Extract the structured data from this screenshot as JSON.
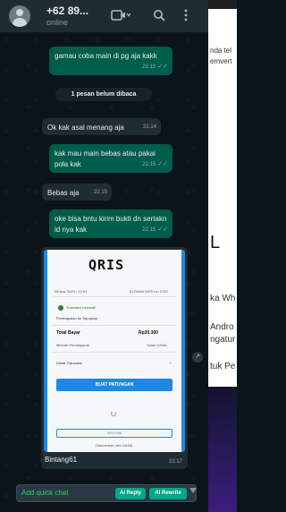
{
  "header": {
    "contact_name": "+62 89...",
    "status": "online"
  },
  "messages": [
    {
      "id": "m1",
      "dir": "out",
      "text": "gamau coba main di pg aja kakk",
      "time": "22.13"
    },
    {
      "id": "m2",
      "dir": "in",
      "text": "Ok kak asal menang aja",
      "time": "22.14"
    },
    {
      "id": "m3",
      "dir": "out",
      "text": "kak mau main bebas atau pakai pola kak",
      "time": "22.15"
    },
    {
      "id": "m4",
      "dir": "in",
      "text": "Bebas aja",
      "time": "22.15"
    },
    {
      "id": "m5",
      "dir": "out",
      "text": "oke bisa bntu kirim bukti dn sertakn id nya kak",
      "time": "22.15"
    }
  ],
  "unread_divider": "1 pesan belum dibaca",
  "image_message": {
    "caption": "Bintang61",
    "time": "22.17",
    "receipt": {
      "logo": "QRIS",
      "date_line": "06 Nov 2025 • 22:04",
      "id_line": "ID DANA 0870 •••• 2720",
      "status": "Transaksi berhasil!",
      "payee": "Pembayaran ke Topupkuy",
      "total_label": "Total Bayar",
      "total_value": "Rp30.300",
      "method_label": "Metode Pembayaran",
      "method_value": "Saldo DANA",
      "detail_label": "Detail Transaksi",
      "primary_button": "BUAT PATUNGAN",
      "secondary_button": "SELESAI",
      "footer": "Diamankan oleh DANA"
    }
  },
  "composer": {
    "placeholder": "Add quick chat",
    "ai_reply": "AI Reply",
    "ai_rewrite": "AI Rewrite"
  },
  "background_page": {
    "line1": "nda tel",
    "line2": "emvert",
    "big_letter": "L",
    "line3": "ka Wh",
    "line4": "Andro",
    "line5": "ngatur",
    "line6": "tuk Pe"
  },
  "colors": {
    "chat_bg": "#0b141a",
    "header_bg": "#202c33",
    "outgoing_bubble": "#005c4b",
    "incoming_bubble": "#202c33",
    "accent_green": "#00a884",
    "read_ticks": "#53bdeb"
  }
}
